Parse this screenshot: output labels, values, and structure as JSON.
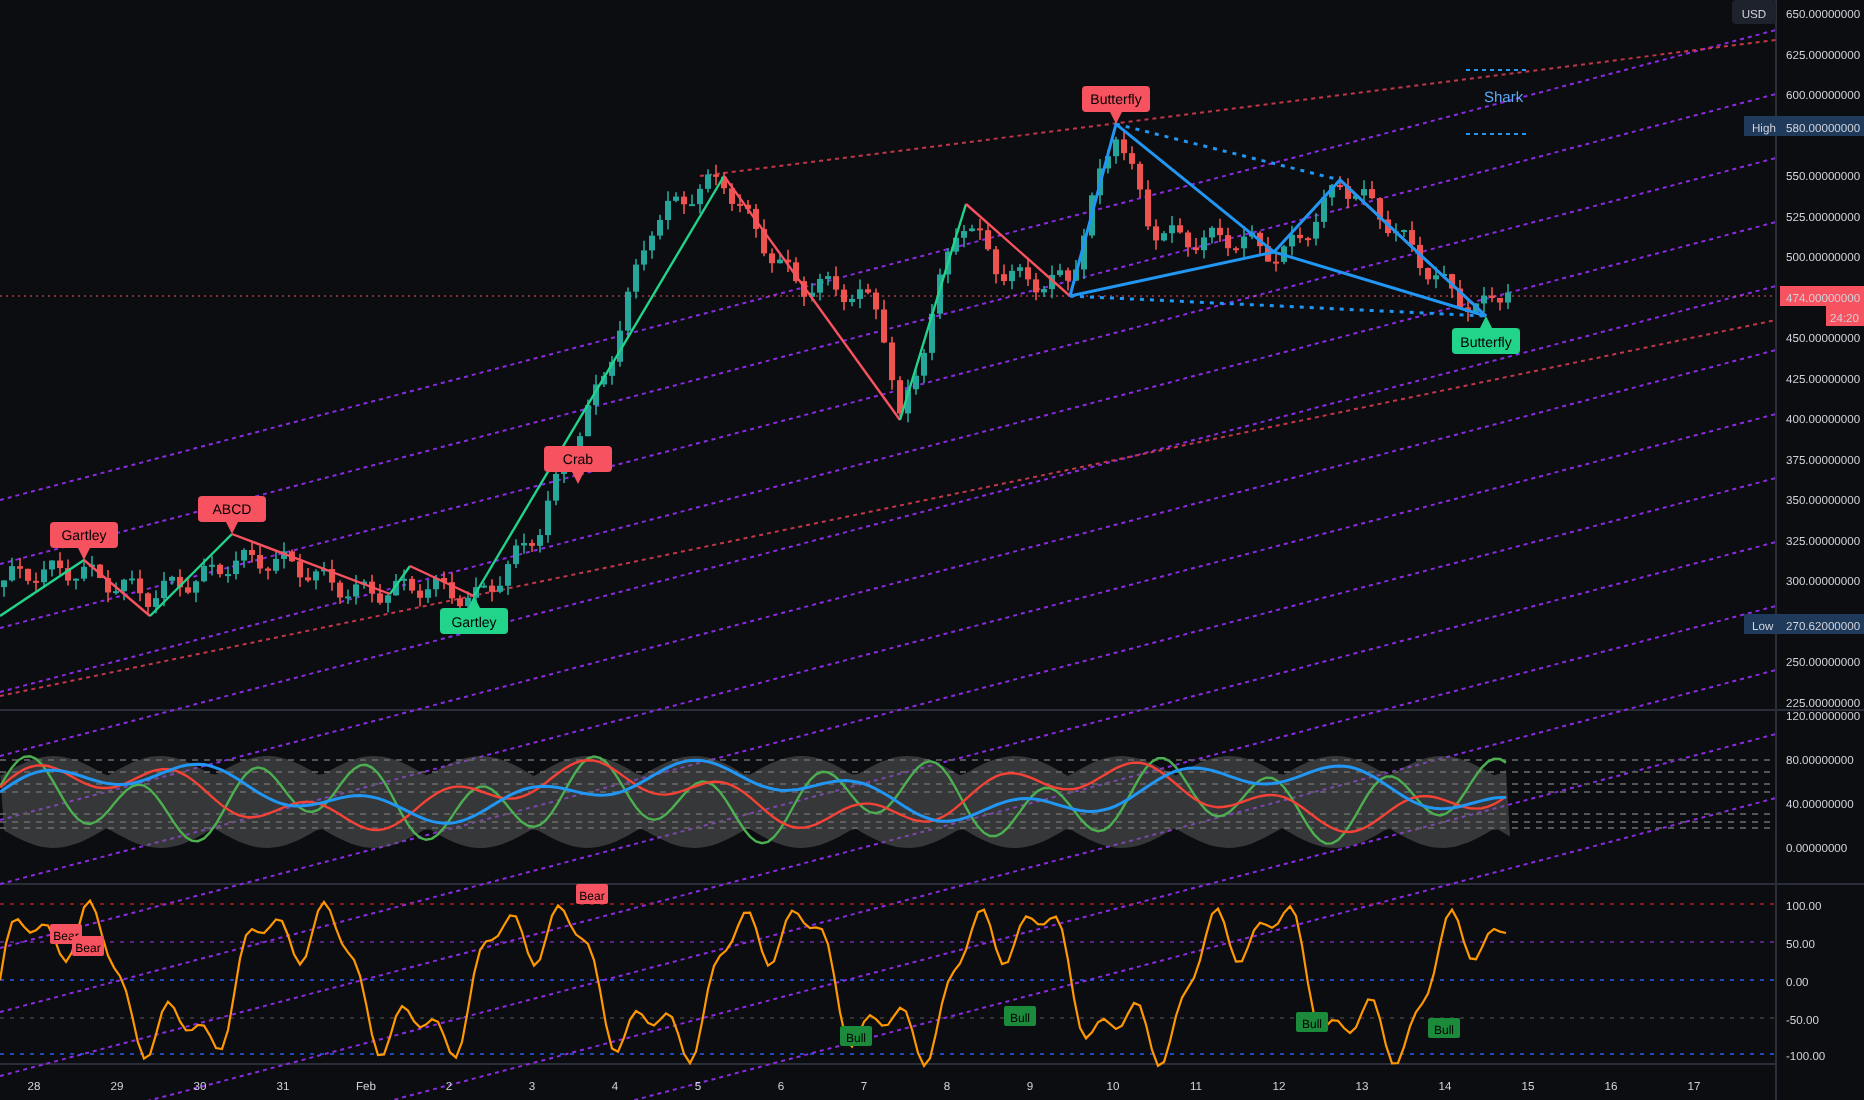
{
  "price_axis": {
    "currency": "USD",
    "ticks": [
      "650.00000000",
      "625.00000000",
      "600.00000000",
      "550.00000000",
      "525.00000000",
      "500.00000000",
      "450.00000000",
      "425.00000000",
      "400.00000000",
      "375.00000000",
      "350.00000000",
      "325.00000000",
      "300.00000000",
      "250.00000000",
      "225.00000000"
    ],
    "high": {
      "label": "High",
      "value": "580.00000000"
    },
    "low": {
      "label": "Low",
      "value": "270.62000000"
    },
    "last_price": "474.00000000",
    "countdown": "24:20"
  },
  "patterns": [
    {
      "text": "Gartley",
      "kind": "bearish"
    },
    {
      "text": "ABCD",
      "kind": "bearish"
    },
    {
      "text": "Gartley",
      "kind": "bullish"
    },
    {
      "text": "Crab",
      "kind": "bearish"
    },
    {
      "text": "Butterfly",
      "kind": "bearish"
    },
    {
      "text": "Butterfly",
      "kind": "bullish"
    }
  ],
  "shark_label": "Shark",
  "oscillator": {
    "ticks": [
      "120.00000000",
      "80.00000000",
      "40.00000000",
      "0.00000000"
    ]
  },
  "momentum": {
    "ticks": [
      "100.00",
      "50.00",
      "0.00",
      "-50.00",
      "-100.00"
    ],
    "signals": [
      {
        "text": "Bear",
        "kind": "bearish"
      },
      {
        "text": "Bear",
        "kind": "bearish"
      },
      {
        "text": "Bear",
        "kind": "bearish"
      },
      {
        "text": "Bull",
        "kind": "bullish"
      },
      {
        "text": "Bull",
        "kind": "bullish"
      },
      {
        "text": "Bull",
        "kind": "bullish"
      },
      {
        "text": "Bull",
        "kind": "bullish"
      }
    ]
  },
  "time_axis": [
    "28",
    "29",
    "30",
    "31",
    "Feb",
    "2",
    "3",
    "4",
    "5",
    "6",
    "7",
    "8",
    "9",
    "10",
    "11",
    "12",
    "13",
    "14",
    "15",
    "16",
    "17"
  ]
}
